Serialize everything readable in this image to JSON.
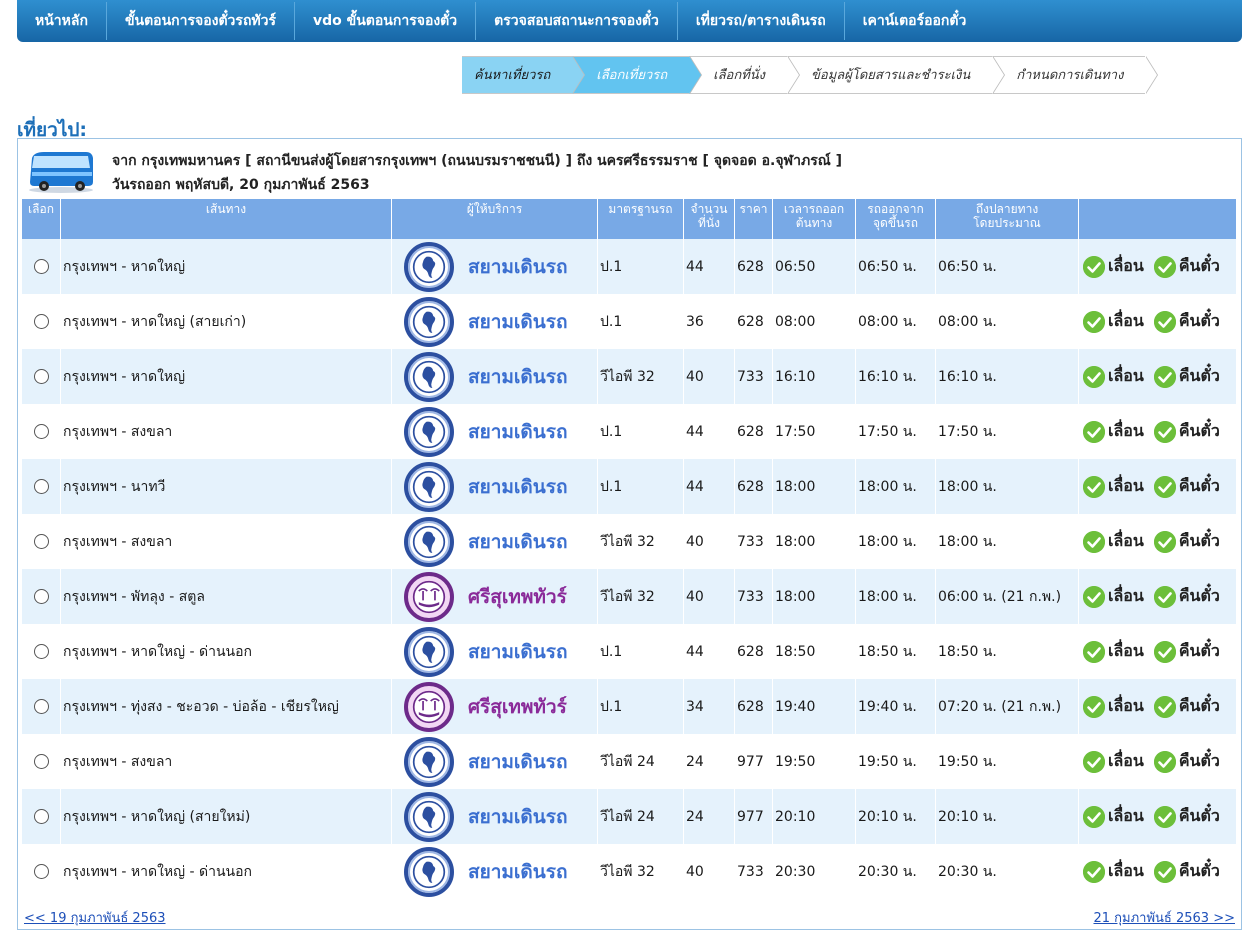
{
  "nav": [
    "หน้าหลัก",
    "ขั้นตอนการจองตั๋วรถทัวร์",
    "vdo ขั้นตอนการจองตั๋ว",
    "ตรวจสอบสถานะการจองตั๋ว",
    "เที่ยวรถ/ตารางเดินรถ",
    "เคาน์เตอร์ออกตั๋ว"
  ],
  "steps": [
    {
      "label": "ค้นหาเที่ยวรถ",
      "state": "active"
    },
    {
      "label": "เลือกเที่ยวรถ",
      "state": "current"
    },
    {
      "label": "เลือกที่นั่ง",
      "state": "pending"
    },
    {
      "label": "ข้อมูลผู้โดยสารและชำระเงิน",
      "state": "pending"
    },
    {
      "label": "กำหนดการเดินทาง",
      "state": "pending"
    }
  ],
  "section_title": "เที่ยวไป:",
  "trip": {
    "route_line": "จาก กรุงเทพมหานคร [ สถานีขนส่งผู้โดยสารกรุงเทพฯ (ถนนบรมราชชนนี) ] ถึง นครศรีธรรมราช [ จุดจอด อ.จุฬาภรณ์ ]",
    "date_line": "วันรถออก พฤหัสบดี, 20 กุมภาพันธ์ 2563"
  },
  "table": {
    "headers": {
      "select": "เลือก",
      "route": "เส้นทาง",
      "operator": "ผู้ให้บริการ",
      "standard": "มาตรฐานรถ",
      "seats": [
        "จำนวน",
        "ที่นั่ง"
      ],
      "price": "ราคา",
      "depart_origin": [
        "เวลารถออก",
        "ต้นทาง"
      ],
      "depart_point": [
        "รถออกจาก",
        "จุดขึ้นรถ"
      ],
      "arrive": [
        "ถึงปลายทาง",
        "โดยประมาณ"
      ],
      "actions": ""
    },
    "rows": [
      {
        "route": "กรุงเทพฯ - หาดใหญ่",
        "operator": "สยามเดินรถ",
        "op": "blue",
        "standard": "ป.1",
        "seats": "44",
        "price": "628",
        "depart_origin": "06:50",
        "depart_point": "06:50 น.",
        "arrive": "06:50 น."
      },
      {
        "route": "กรุงเทพฯ - หาดใหญ่ (สายเก่า)",
        "operator": "สยามเดินรถ",
        "op": "blue",
        "standard": "ป.1",
        "seats": "36",
        "price": "628",
        "depart_origin": "08:00",
        "depart_point": "08:00 น.",
        "arrive": "08:00 น."
      },
      {
        "route": "กรุงเทพฯ - หาดใหญ่",
        "operator": "สยามเดินรถ",
        "op": "blue",
        "standard": "วีไอพี 32",
        "seats": "40",
        "price": "733",
        "depart_origin": "16:10",
        "depart_point": "16:10 น.",
        "arrive": "16:10 น."
      },
      {
        "route": "กรุงเทพฯ - สงขลา",
        "operator": "สยามเดินรถ",
        "op": "blue",
        "standard": "ป.1",
        "seats": "44",
        "price": "628",
        "depart_origin": "17:50",
        "depart_point": "17:50 น.",
        "arrive": "17:50 น."
      },
      {
        "route": "กรุงเทพฯ - นาทวี",
        "operator": "สยามเดินรถ",
        "op": "blue",
        "standard": "ป.1",
        "seats": "44",
        "price": "628",
        "depart_origin": "18:00",
        "depart_point": "18:00 น.",
        "arrive": "18:00 น."
      },
      {
        "route": "กรุงเทพฯ - สงขลา",
        "operator": "สยามเดินรถ",
        "op": "blue",
        "standard": "วีไอพี 32",
        "seats": "40",
        "price": "733",
        "depart_origin": "18:00",
        "depart_point": "18:00 น.",
        "arrive": "18:00 น."
      },
      {
        "route": "กรุงเทพฯ - พัทลุง - สตูล",
        "operator": "ศรีสุเทพทัวร์",
        "op": "purple",
        "standard": "วีไอพี 32",
        "seats": "40",
        "price": "733",
        "depart_origin": "18:00",
        "depart_point": "18:00 น.",
        "arrive": "06:00 น. (21 ก.พ.)"
      },
      {
        "route": "กรุงเทพฯ - หาดใหญ่ - ด่านนอก",
        "operator": "สยามเดินรถ",
        "op": "blue",
        "standard": "ป.1",
        "seats": "44",
        "price": "628",
        "depart_origin": "18:50",
        "depart_point": "18:50 น.",
        "arrive": "18:50 น."
      },
      {
        "route": "กรุงเทพฯ - ทุ่งสง - ชะอวด - บ่อล้อ - เชียรใหญ่",
        "operator": "ศรีสุเทพทัวร์",
        "op": "purple",
        "standard": "ป.1",
        "seats": "34",
        "price": "628",
        "depart_origin": "19:40",
        "depart_point": "19:40 น.",
        "arrive": "07:20 น. (21 ก.พ.)"
      },
      {
        "route": "กรุงเทพฯ - สงขลา",
        "operator": "สยามเดินรถ",
        "op": "blue",
        "standard": "วีไอพี 24",
        "seats": "24",
        "price": "977",
        "depart_origin": "19:50",
        "depart_point": "19:50 น.",
        "arrive": "19:50 น."
      },
      {
        "route": "กรุงเทพฯ - หาดใหญ่ (สายใหม่)",
        "operator": "สยามเดินรถ",
        "op": "blue",
        "standard": "วีไอพี 24",
        "seats": "24",
        "price": "977",
        "depart_origin": "20:10",
        "depart_point": "20:10 น.",
        "arrive": "20:10 น."
      },
      {
        "route": "กรุงเทพฯ - หาดใหญ่ - ด่านนอก",
        "operator": "สยามเดินรถ",
        "op": "blue",
        "standard": "วีไอพี 32",
        "seats": "40",
        "price": "733",
        "depart_origin": "20:30",
        "depart_point": "20:30 น.",
        "arrive": "20:30 น."
      }
    ],
    "action_postpone": "เลื่อน",
    "action_refund": "คืนตั๋ว"
  },
  "pager": {
    "prev": "<< 19 กุมภาพันธ์ 2563",
    "next": "21 กุมภาพันธ์ 2563 >>"
  },
  "colors": {
    "nav": "#1766a6",
    "header": "#78a9e6",
    "row_alt": "#e5f2fc",
    "siam": "#3b6fd0",
    "srisuthep": "#8a2a99",
    "check": "#6cbf3a"
  },
  "icons": {
    "bus": "bus-icon",
    "check": "check-circle-icon",
    "siam_logo": "siam-thailand-map-logo-icon",
    "srisuthep_logo": "srisuthep-palm-logo-icon"
  }
}
